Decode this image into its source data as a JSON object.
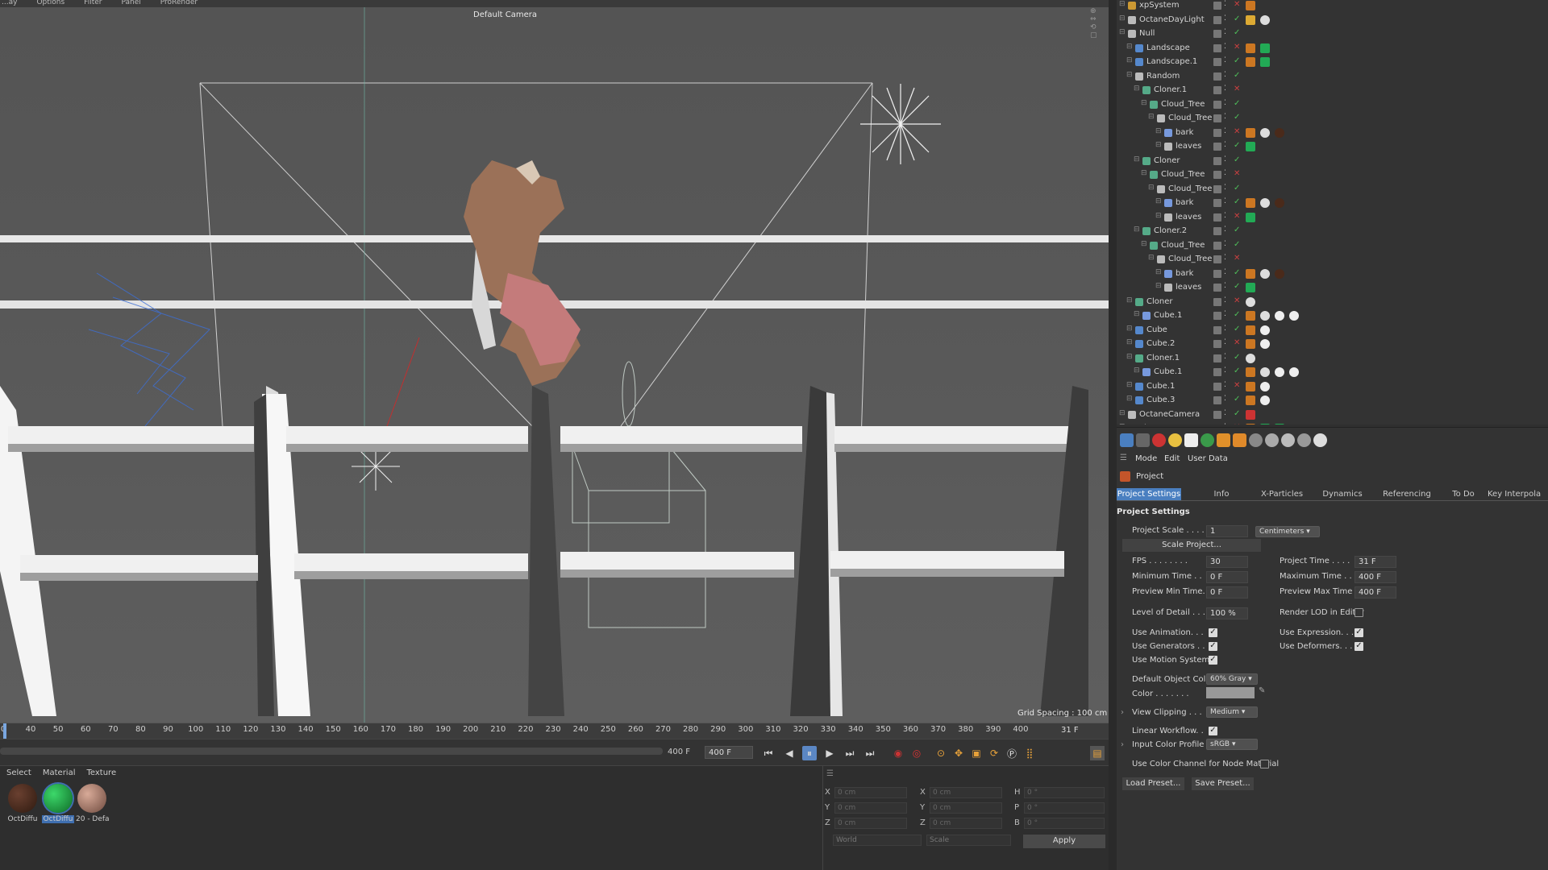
{
  "menubar": {
    "items": [
      "...ay",
      "Options",
      "Filter",
      "Panel",
      "ProRender"
    ]
  },
  "viewport": {
    "camera_label": "Default Camera ",
    "grid_spacing": "Grid Spacing : 100 cm"
  },
  "timeline": {
    "ticks": [
      "0",
      "40",
      "50",
      "60",
      "70",
      "80",
      "90",
      "100",
      "110",
      "120",
      "130",
      "140",
      "150",
      "160",
      "170",
      "180",
      "190",
      "200",
      "210",
      "220",
      "230",
      "240",
      "250",
      "260",
      "270",
      "280",
      "290",
      "300",
      "310",
      "320",
      "330",
      "340",
      "350",
      "360",
      "370",
      "380",
      "390",
      "400"
    ],
    "current_frame": "31 F",
    "cursor_fraction": 0.0
  },
  "transport": {
    "end_frame_label": "400 F",
    "end_frame_field": "400 F"
  },
  "materials": {
    "menu": [
      "Select",
      "Material",
      "Texture"
    ],
    "items": [
      {
        "label": "OctDiffu",
        "color": "#4a2a1a"
      },
      {
        "label": "OctDiffu",
        "color": "#1f9a3c"
      },
      {
        "label": "20 - Defa",
        "color": "#b58a7a"
      }
    ]
  },
  "coords": {
    "rows": [
      {
        "a": "X",
        "av": "0 cm",
        "b": "X",
        "bv": "0 cm",
        "c": "H",
        "cv": "0 °"
      },
      {
        "a": "Y",
        "av": "0 cm",
        "b": "Y",
        "bv": "0 cm",
        "c": "P",
        "cv": "0 °"
      },
      {
        "a": "Z",
        "av": "0 cm",
        "b": "Z",
        "bv": "0 cm",
        "c": "B",
        "cv": "0 °"
      }
    ],
    "mode1": "World",
    "mode2": "Scale",
    "apply": "Apply"
  },
  "objects": [
    {
      "name": "xpSystem",
      "indent": 0,
      "icon": "#cc9933",
      "tags": [
        "#cc7722"
      ]
    },
    {
      "name": "OctaneDayLight",
      "indent": 0,
      "icon": "#bbbbbb",
      "tags": [
        "#ddaa33",
        "#dddddd"
      ]
    },
    {
      "name": "Null",
      "indent": 0,
      "icon": "#bbbbbb",
      "tags": []
    },
    {
      "name": "Landscape",
      "indent": 1,
      "icon": "#5588cc",
      "tags": [
        "#cc7722",
        "#22aa55"
      ]
    },
    {
      "name": "Landscape.1",
      "indent": 1,
      "icon": "#5588cc",
      "tags": [
        "#cc7722",
        "#22aa55"
      ]
    },
    {
      "name": "Random",
      "indent": 1,
      "icon": "#bbbbbb",
      "tags": []
    },
    {
      "name": "Cloner.1",
      "indent": 2,
      "icon": "#55aa88",
      "tags": []
    },
    {
      "name": "Cloud_Tree",
      "indent": 3,
      "icon": "#55aa88",
      "tags": []
    },
    {
      "name": "Cloud_Tree",
      "indent": 4,
      "icon": "#bbbbbb",
      "tags": []
    },
    {
      "name": "bark",
      "indent": 5,
      "icon": "#7799dd",
      "tags": [
        "#cc7722",
        "#dddddd",
        "#4a2a1a"
      ]
    },
    {
      "name": "leaves",
      "indent": 5,
      "icon": "#bbbbbb",
      "tags": [
        "#22aa55"
      ]
    },
    {
      "name": "Cloner",
      "indent": 2,
      "icon": "#55aa88",
      "tags": []
    },
    {
      "name": "Cloud_Tree",
      "indent": 3,
      "icon": "#55aa88",
      "tags": []
    },
    {
      "name": "Cloud_Tree",
      "indent": 4,
      "icon": "#bbbbbb",
      "tags": []
    },
    {
      "name": "bark",
      "indent": 5,
      "icon": "#7799dd",
      "tags": [
        "#cc7722",
        "#dddddd",
        "#4a2a1a"
      ]
    },
    {
      "name": "leaves",
      "indent": 5,
      "icon": "#bbbbbb",
      "tags": [
        "#22aa55"
      ]
    },
    {
      "name": "Cloner.2",
      "indent": 2,
      "icon": "#55aa88",
      "tags": []
    },
    {
      "name": "Cloud_Tree",
      "indent": 3,
      "icon": "#55aa88",
      "tags": []
    },
    {
      "name": "Cloud_Tree",
      "indent": 4,
      "icon": "#bbbbbb",
      "tags": []
    },
    {
      "name": "bark",
      "indent": 5,
      "icon": "#7799dd",
      "tags": [
        "#cc7722",
        "#dddddd",
        "#4a2a1a"
      ]
    },
    {
      "name": "leaves",
      "indent": 5,
      "icon": "#bbbbbb",
      "tags": [
        "#22aa55"
      ]
    },
    {
      "name": "Cloner",
      "indent": 1,
      "icon": "#55aa88",
      "tags": [
        "#dddddd"
      ]
    },
    {
      "name": "Cube.1",
      "indent": 2,
      "icon": "#7799dd",
      "tags": [
        "#cc7722",
        "#dddddd",
        "#eeeeee",
        "#eeeeee"
      ]
    },
    {
      "name": "Cube",
      "indent": 1,
      "icon": "#5588cc",
      "tags": [
        "#cc7722",
        "#eeeeee"
      ]
    },
    {
      "name": "Cube.2",
      "indent": 1,
      "icon": "#5588cc",
      "tags": [
        "#cc7722",
        "#eeeeee"
      ]
    },
    {
      "name": "Cloner.1",
      "indent": 1,
      "icon": "#55aa88",
      "tags": [
        "#dddddd"
      ]
    },
    {
      "name": "Cube.1",
      "indent": 2,
      "icon": "#7799dd",
      "tags": [
        "#cc7722",
        "#dddddd",
        "#eeeeee",
        "#eeeeee"
      ]
    },
    {
      "name": "Cube.1",
      "indent": 1,
      "icon": "#5588cc",
      "tags": [
        "#cc7722",
        "#eeeeee"
      ]
    },
    {
      "name": "Cube.3",
      "indent": 1,
      "icon": "#5588cc",
      "tags": [
        "#cc7722",
        "#eeeeee"
      ]
    },
    {
      "name": "OctaneCamera",
      "indent": 0,
      "icon": "#bbbbbb",
      "tags": [
        "#cc3333"
      ]
    },
    {
      "name": "Plane",
      "indent": 0,
      "icon": "#5588cc",
      "tags": [
        "#cc7722",
        "#22aa55",
        "#22aa55"
      ]
    }
  ],
  "attr": {
    "menu": [
      "Mode",
      "Edit",
      "User Data"
    ],
    "title": "Project",
    "tabs": [
      "Project Settings",
      "Info",
      "X-Particles",
      "Dynamics",
      "Referencing",
      "To Do",
      "Key Interpola"
    ],
    "section": "Project Settings",
    "project_scale": {
      "label": "Project Scale . . . .",
      "value": "1",
      "unit": "Centimeters"
    },
    "scale_project": "Scale Project...",
    "fps": {
      "label": "FPS . . . . . . . .",
      "value": "30"
    },
    "project_time": {
      "label": "Project Time . . . .",
      "value": "31 F"
    },
    "min_time": {
      "label": "Minimum Time . .",
      "value": "0 F"
    },
    "max_time": {
      "label": "Maximum Time . .",
      "value": "400 F"
    },
    "prev_min": {
      "label": "Preview Min Time.",
      "value": "0 F"
    },
    "prev_max": {
      "label": "Preview Max Time",
      "value": "400 F"
    },
    "lod": {
      "label": "Level of Detail . . .",
      "value": "100 %"
    },
    "render_lod": "Render LOD in Editor",
    "use_anim": "Use Animation. . .",
    "use_expr": "Use Expression. . .",
    "use_gen": "Use Generators . .",
    "use_def": "Use Deformers. . .",
    "use_motion": "Use Motion System",
    "def_color": {
      "label": "Default Object Color",
      "value": "60% Gray"
    },
    "color": "Color . . . . . . .",
    "view_clip": {
      "label": "View Clipping . . .",
      "value": "Medium"
    },
    "linear": "Linear Workflow. .",
    "icp": {
      "label": "Input Color Profile",
      "value": "sRGB"
    },
    "color_channel": "Use Color Channel for Node Material",
    "load_preset": "Load Preset...",
    "save_preset": "Save Preset..."
  }
}
